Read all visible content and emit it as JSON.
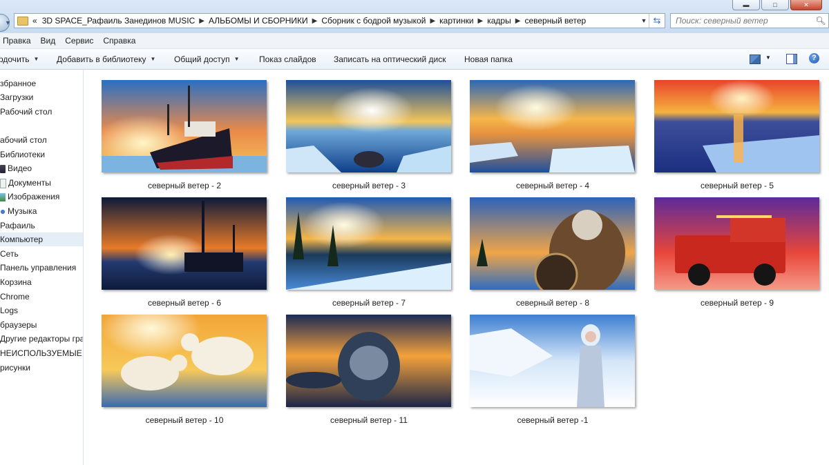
{
  "window": {
    "minimize_glyph": "▬",
    "maximize_glyph": "□",
    "close_glyph": "✕"
  },
  "address": {
    "overflow_glyph": "«",
    "crumbs": [
      "3D SPACE_Рафаиль Занединов MUSIC",
      "АЛЬБОМЫ И СБОРНИКИ",
      "Сборник с бодрой музыкой",
      "картинки",
      "кадры",
      "северный ветер"
    ]
  },
  "search": {
    "placeholder": "Поиск: северный ветер"
  },
  "menu": [
    "Правка",
    "Вид",
    "Сервис",
    "Справка"
  ],
  "commands": {
    "organize": "рдочить",
    "add_library": "Добавить в библиотеку",
    "share": "Общий доступ",
    "slideshow": "Показ слайдов",
    "burn": "Записать на оптический диск",
    "new_folder": "Новая папка",
    "help": "?"
  },
  "nav": [
    "збранное",
    "Загрузки",
    "Рабочий стол",
    "абочий стол",
    "Библиотеки",
    "Видео",
    "Документы",
    "Изображения",
    "Музыка",
    "Рафаиль",
    "Компьютер",
    "Сеть",
    "Панель управления",
    "Корзина",
    "Chrome",
    "Logs",
    "браузеры",
    "Другие редакторы гра",
    "НЕИСПОЛЬЗУЕМЫЕ ЯР.",
    "рисунки"
  ],
  "files": [
    {
      "name": "северный ветер - 2",
      "scene": "icebreaker"
    },
    {
      "name": "северный ветер - 3",
      "scene": "ice-sunset"
    },
    {
      "name": "северный ветер - 4",
      "scene": "ice-sunset"
    },
    {
      "name": "северный ветер - 5",
      "scene": "red-sunset"
    },
    {
      "name": "северный ветер - 6",
      "scene": "rig"
    },
    {
      "name": "северный ветер - 7",
      "scene": "forest"
    },
    {
      "name": "северный ветер - 8",
      "scene": "viking"
    },
    {
      "name": "северный ветер - 9",
      "scene": "truck"
    },
    {
      "name": "северный ветер - 10",
      "scene": "bears"
    },
    {
      "name": "северный ветер - 11",
      "scene": "seal"
    },
    {
      "name": "северный ветер -1",
      "scene": "ice-queen"
    }
  ]
}
